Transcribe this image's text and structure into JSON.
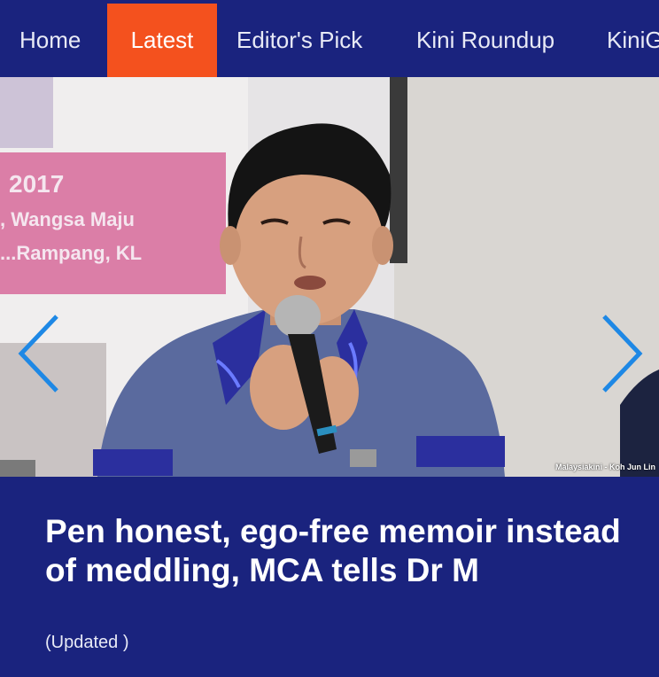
{
  "nav": {
    "items": [
      {
        "label": "Home"
      },
      {
        "label": "Latest"
      },
      {
        "label": "Editor's Pick"
      },
      {
        "label": "Kini Roundup"
      },
      {
        "label": "KiniG"
      }
    ],
    "active_index": 1
  },
  "hero": {
    "photo_credit": "Malaysiakini - Koh Jun Lin",
    "banner_text": {
      "line1": "2017",
      "line2": ", Wangsa Maju",
      "line3": "...Rampang, KL"
    }
  },
  "article": {
    "headline": "Pen honest, ego-free memoir instead of meddling, MCA tells Dr M",
    "status": "(Updated )"
  },
  "colors": {
    "nav_background": "#1a237e",
    "active_tab": "#f4511e",
    "arrow": "#1e88e5"
  },
  "icons": {
    "prev": "chevron-left-icon",
    "next": "chevron-right-icon"
  }
}
